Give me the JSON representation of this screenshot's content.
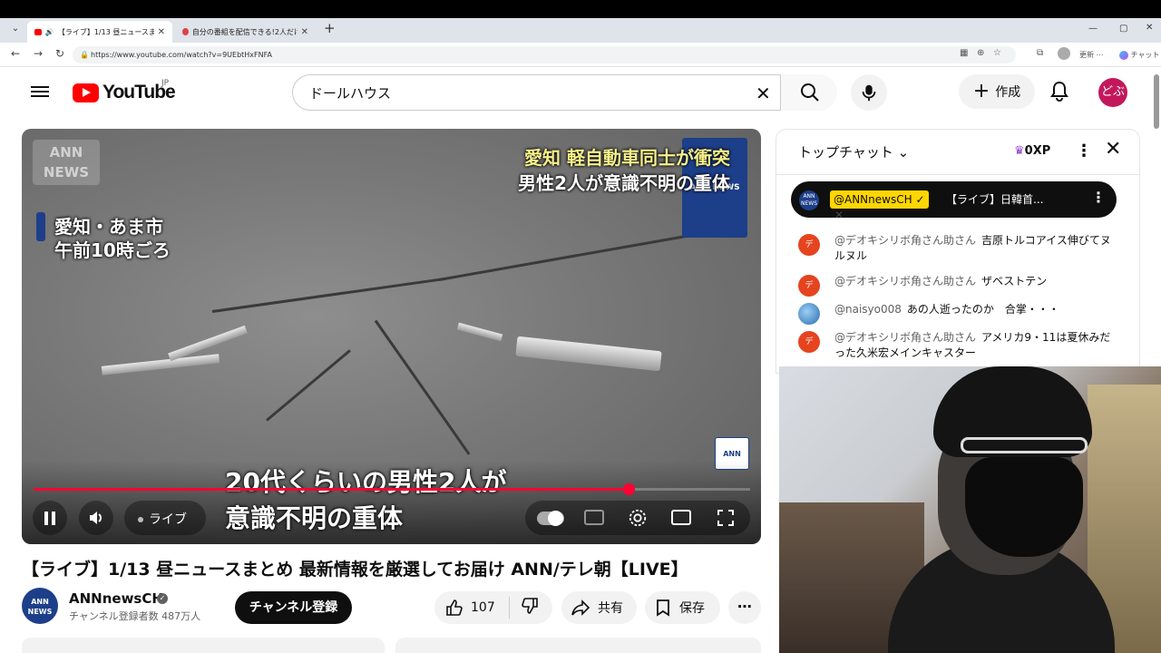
{
  "browser": {
    "tabs": [
      {
        "title": "【ライブ】1/13 昼ニュースまとめ 最",
        "active": true
      },
      {
        "title": "自分の番組を配信できる!2人だけでう",
        "active": false
      }
    ],
    "url": "https://www.youtube.com/watch?v=9UEbtHxFNFA",
    "new_tab_label": "+",
    "update_label": "更新",
    "chat_label": "チャット"
  },
  "header": {
    "logo_text": "YouTube",
    "logo_region": "JP",
    "search_value": "ドールハウス",
    "create_label": "作成",
    "avatar_text": "どぶ"
  },
  "video": {
    "caption_top_left": [
      "愛知・あま市",
      "午前10時ごろ"
    ],
    "caption_top_right": [
      "愛知 軽自動車同士が衝突",
      "男性2人が意識不明の重体"
    ],
    "subtitle": [
      "20代くらいの男性2人が",
      "意識不明の重体"
    ],
    "watermark": "ANN NEWS",
    "live_label": "ライブ",
    "progress": 0.83,
    "title": "【ライブ】1/13 昼ニュースまとめ 最新情報を厳選してお届け ANN/テレ朝【LIVE】"
  },
  "channel": {
    "name": "ANNnewsCH",
    "subscribers": "チャンネル登録者数 487万人",
    "subscribe_label": "チャンネル登録",
    "likes": "107",
    "share_label": "共有",
    "save_label": "保存"
  },
  "chat": {
    "title": "トップチャット",
    "xp": "0XP",
    "pinned": {
      "author": "@ANNnewsCH",
      "message": "【ライブ】日韓首..."
    },
    "messages": [
      {
        "author": "@デオキシリボ角さん助さん",
        "text": "吉原トルコアイス伸びてヌルヌル",
        "avatar": "デ"
      },
      {
        "author": "@デオキシリボ角さん助さん",
        "text": "ザベストテン",
        "avatar": "デ"
      },
      {
        "author": "@naisyo008",
        "text": "あの人逝ったのか　合掌・・・",
        "avatar": ""
      },
      {
        "author": "@デオキシリボ角さん助さん",
        "text": "アメリカ9・11は夏休みだった久米宏メインキャスター",
        "avatar": "デ"
      }
    ]
  },
  "colors": {
    "brand_red": "#ff0000",
    "progress_red": "#ff0033",
    "pinned_author_bg": "#ffd600"
  }
}
